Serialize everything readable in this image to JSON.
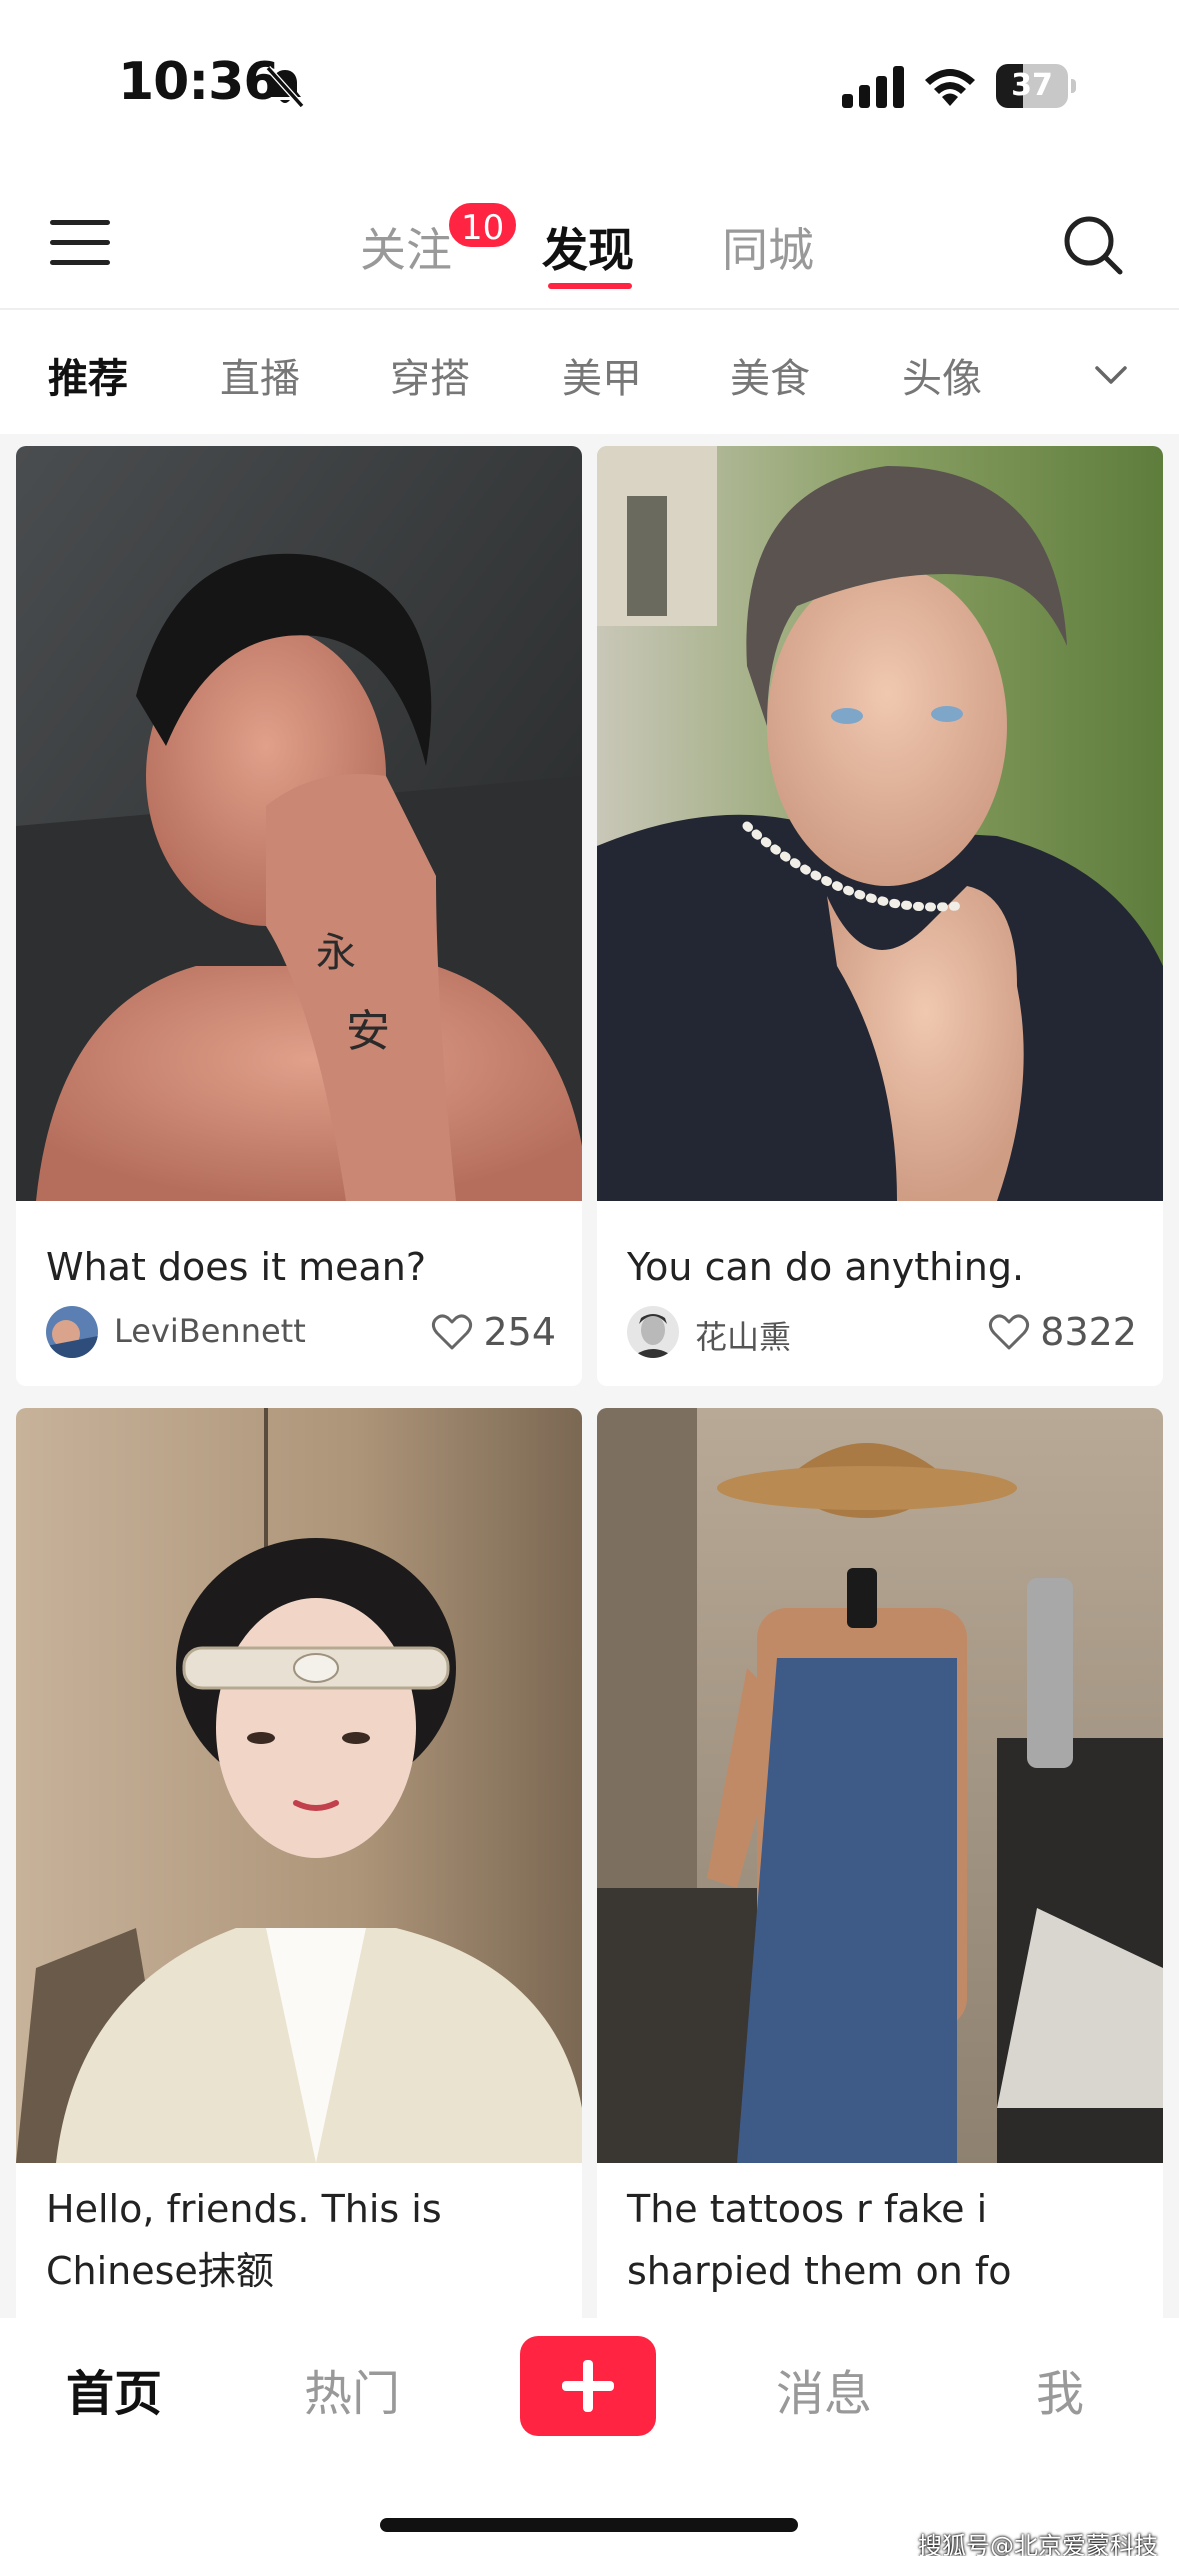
{
  "status_bar": {
    "time": "10:36",
    "battery": "37",
    "battery_level": 0.37
  },
  "top_nav": {
    "tabs": [
      {
        "label": "关注",
        "badge": "10"
      },
      {
        "label": "发现"
      },
      {
        "label": "同城"
      }
    ],
    "active_tab": "发现"
  },
  "categories": {
    "items": [
      "推荐",
      "直播",
      "穿搭",
      "美甲",
      "美食",
      "头像"
    ],
    "active": "推荐"
  },
  "feed": {
    "cards": [
      {
        "title": "What does it mean?",
        "author": "LeviBennett",
        "likes": "254"
      },
      {
        "title": "You can do anything.",
        "author": "花山熏",
        "likes": "8322"
      },
      {
        "title_lines": [
          "Hello, friends. This is",
          "Chinese抹额"
        ]
      },
      {
        "title_lines": [
          "The tattoos r fake i",
          "sharpied them on fo"
        ]
      }
    ]
  },
  "bottom_nav": {
    "items": [
      "首页",
      "热门",
      "消息",
      "我"
    ],
    "active": "首页"
  },
  "watermark": "搜狐号@北京爱蒙科技",
  "colors": {
    "accent": "#ff2442",
    "feed_bg": "#f5f5f5"
  },
  "icons": [
    "bell-muted-icon",
    "signal-icon",
    "wifi-icon",
    "battery-icon",
    "menu-icon",
    "search-icon",
    "chevron-down-icon",
    "heart-icon",
    "plus-icon"
  ]
}
